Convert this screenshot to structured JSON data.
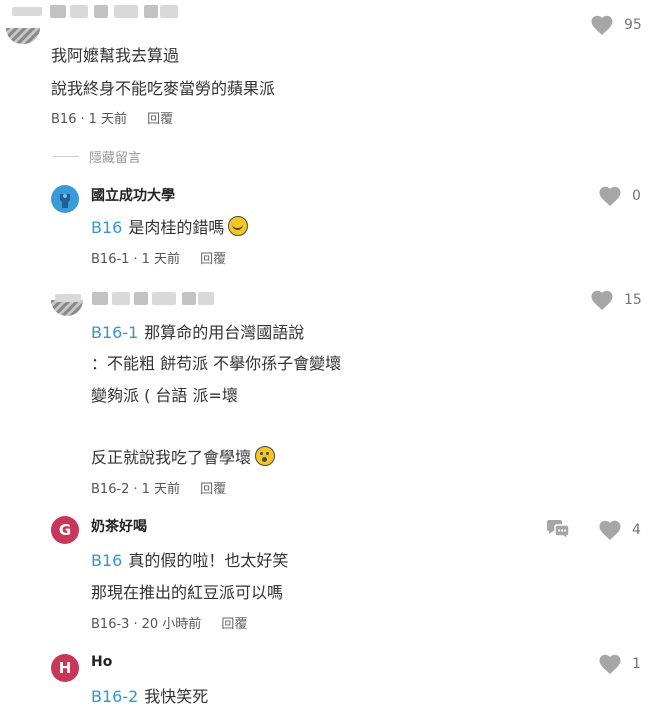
{
  "comments": [
    {
      "user": "",
      "lines": [
        "我阿嬤幫我去算過",
        "說我終身不能吃麥當勞的蘋果派"
      ],
      "floor": "B16",
      "time": "1 天前",
      "reply": "回覆",
      "likes": "95"
    },
    {
      "user": "國立成功大學",
      "ref": "B16",
      "lines": [
        "是肉桂的錯嗎"
      ],
      "floor": "B16-1",
      "time": "1 天前",
      "reply": "回覆",
      "likes": "0"
    },
    {
      "user": "",
      "ref": "B16-1",
      "lines": [
        "那算命的用台灣國語說",
        "：不能粗 餅苟派 不擧你孫子會變壞",
        "變夠派 ( 台語 派=壞",
        "",
        "反正就說我吃了會學壞"
      ],
      "floor": "B16-2",
      "time": "1 天前",
      "reply": "回覆",
      "likes": "15"
    },
    {
      "user": "奶茶好喝",
      "avatar_letter": "G",
      "ref": "B16",
      "lines": [
        "真的假的啦！也太好笑",
        "那現在推出的紅豆派可以嗎"
      ],
      "floor": "B16-3",
      "time": "20 小時前",
      "reply": "回覆",
      "likes": "4"
    },
    {
      "user": "Ho",
      "avatar_letter": "H",
      "ref": "B16-2",
      "lines": [
        "我快笑死"
      ],
      "likes": "1"
    }
  ],
  "hidden_toggle": "隱藏留言",
  "colors": {
    "floor_link": "#3397cf",
    "avatar_g": "#c8365a",
    "avatar_h": "#c8365a",
    "avatar_school": "#3a9bd9",
    "icon_grey": "#a6a6a6"
  },
  "icons": {
    "like": "heart-icon",
    "message": "chat-bubble-icon"
  }
}
